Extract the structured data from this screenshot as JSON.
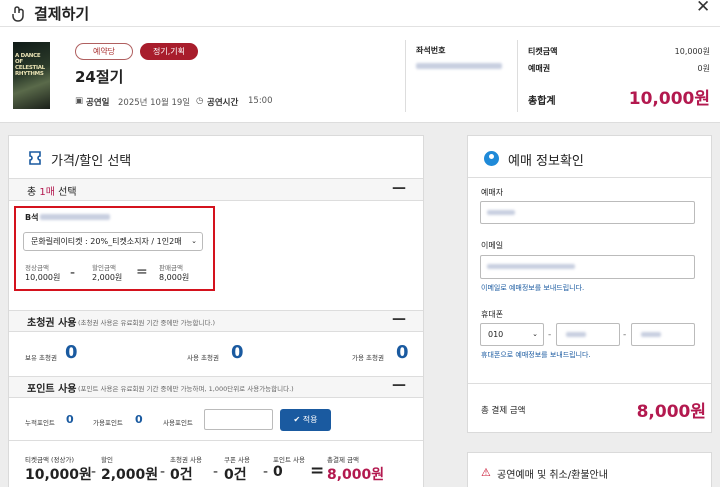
{
  "window": {
    "title": "결제하기"
  },
  "show": {
    "tag_presale": "예약당",
    "tag_regular": "정기,기획",
    "title": "24절기",
    "date_label": "공연일",
    "date_value": "2025년 10월 19일",
    "time_label": "공연시간",
    "time_value": "15:00",
    "poster_lines": [
      "A DANCE",
      "OF",
      "CELESTIAL",
      "RHYTHMS"
    ]
  },
  "seat": {
    "label": "좌석번호"
  },
  "summary": {
    "ticket_label": "티켓금액",
    "ticket_value": "10,000원",
    "coupon_label": "예매권",
    "coupon_value": "0원",
    "total_label": "총합계",
    "total_value": "10,000원"
  },
  "price": {
    "panel_title": "가격/할인 선택",
    "count_prefix": "총 ",
    "count_num": "1매",
    "count_suffix": " 선택",
    "grade": "B석",
    "discount_selected": "문화릴레이티켓 : 20%_티켓소지자 / 1인2매",
    "normal_label": "정상금액",
    "normal_value": "10,000원",
    "disc_label": "할인금액",
    "disc_value": "2,000원",
    "sale_label": "판매금액",
    "sale_value": "8,000원"
  },
  "invite": {
    "title": "초청권 사용",
    "note": "(초청권 사용은 유료회원 기간 중에만 가능합니다.)",
    "owned_label": "보유 초청권",
    "owned_value": "0",
    "use_label": "사용 초청권",
    "use_value": "0",
    "avail_label": "가용 초청권",
    "avail_value": "0"
  },
  "point": {
    "title": "포인트 사용",
    "note": "(포인트 사용은 유료회원 기간 중에만 가능하며, 1,000단위로 사용가능합니다.)",
    "acc_label": "누적포인트",
    "acc_value": "0",
    "avail_label": "가용포인트",
    "avail_value": "0",
    "use_label": "사용포인트",
    "apply_label": "적용"
  },
  "totals": {
    "items": [
      {
        "label": "티켓금액 (정상가)",
        "value": "10,000원"
      },
      {
        "label": "할인",
        "value": "2,000원"
      },
      {
        "label": "초청권 사용",
        "value": "0건"
      },
      {
        "label": "쿠폰 사용",
        "value": "0건"
      },
      {
        "label": "포인트 사용",
        "value": "0"
      },
      {
        "label": "총결제 금액",
        "value": "8,000원"
      }
    ]
  },
  "booking": {
    "panel_title": "예매 정보확인",
    "booker_label": "예매자",
    "email_label": "이메일",
    "email_hint": "이메일로 예매정보를 보내드립니다.",
    "phone_label": "휴대폰",
    "phone_prefix": "010",
    "phone_hint": "휴대폰으로 예매정보를 보내드립니다.",
    "total_label": "총 결제 금액",
    "total_value": "8,000원"
  },
  "notice": {
    "title": "공연예매 및 취소/환불안내"
  },
  "colors": {
    "accent": "#1a5aa0",
    "total": "#b3194f",
    "red_box": "#d4121d"
  },
  "icons": {
    "app": "hand-icon",
    "close": "close-icon",
    "price": "ticket-icon",
    "booking": "user-icon",
    "notice": "warning-icon"
  }
}
